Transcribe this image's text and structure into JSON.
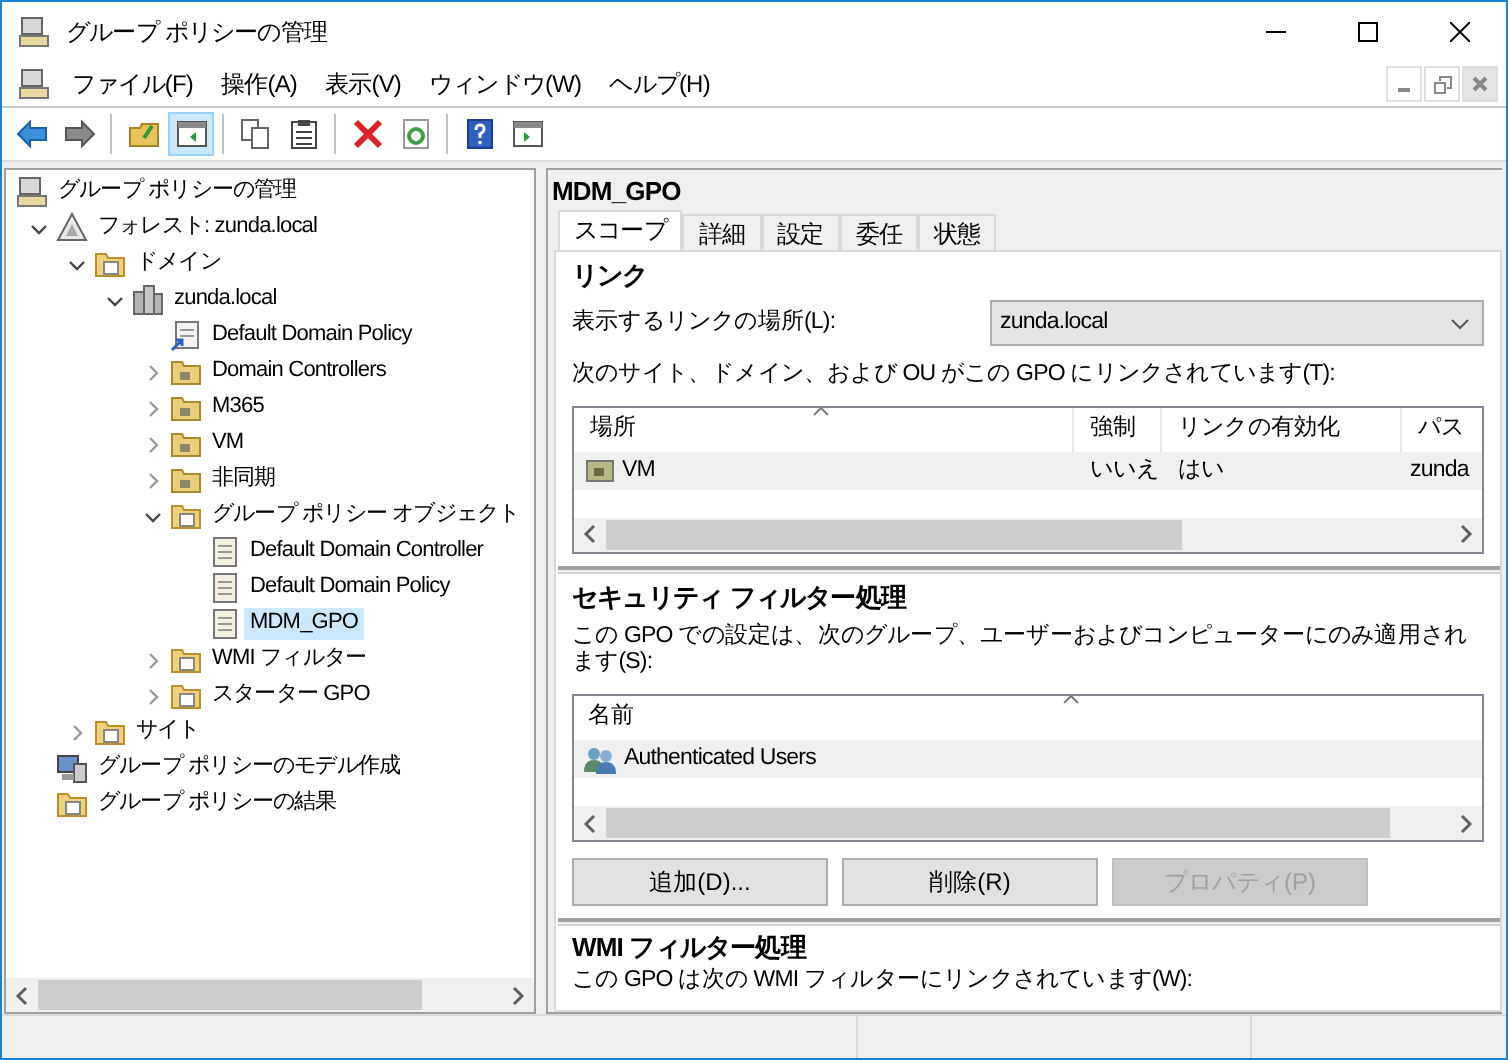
{
  "window": {
    "title": "グループ ポリシーの管理"
  },
  "menu": [
    {
      "label": "ファイル(F)"
    },
    {
      "label": "操作(A)"
    },
    {
      "label": "表示(V)"
    },
    {
      "label": "ウィンドウ(W)"
    },
    {
      "label": "ヘルプ(H)"
    }
  ],
  "toolbar": [
    {
      "kind": "back",
      "pressed": false
    },
    {
      "kind": "forward",
      "pressed": false
    },
    {
      "kind": "sep"
    },
    {
      "kind": "up",
      "pressed": false
    },
    {
      "kind": "tree",
      "pressed": true
    },
    {
      "kind": "sep"
    },
    {
      "kind": "copy",
      "pressed": false
    },
    {
      "kind": "paste",
      "pressed": false
    },
    {
      "kind": "sep"
    },
    {
      "kind": "delete",
      "pressed": false
    },
    {
      "kind": "refresh",
      "pressed": false
    },
    {
      "kind": "sep"
    },
    {
      "kind": "help",
      "pressed": false
    },
    {
      "kind": "panel",
      "pressed": false
    }
  ],
  "tree": [
    {
      "label": "グループ ポリシーの管理",
      "kind": "console",
      "selected": false,
      "children": [
        {
          "label": "フォレスト: zunda.local",
          "kind": "forest",
          "expanded": true,
          "selected": false,
          "children": [
            {
              "label": "ドメイン",
              "kind": "folder",
              "expanded": true,
              "selected": false,
              "children": [
                {
                  "label": "zunda.local",
                  "kind": "domain",
                  "expanded": true,
                  "selected": false,
                  "children": [
                    {
                      "label": "Default Domain Policy",
                      "kind": "link",
                      "selected": false
                    },
                    {
                      "label": "Domain Controllers",
                      "kind": "ou",
                      "expanded": false,
                      "selected": false
                    },
                    {
                      "label": "M365",
                      "kind": "ou",
                      "expanded": false,
                      "selected": false
                    },
                    {
                      "label": "VM",
                      "kind": "ou",
                      "expanded": false,
                      "selected": false
                    },
                    {
                      "label": "非同期",
                      "kind": "ou",
                      "expanded": false,
                      "selected": false
                    },
                    {
                      "label": "グループ ポリシー オブジェクト",
                      "kind": "folder",
                      "expanded": true,
                      "selected": false,
                      "children": [
                        {
                          "label": "Default Domain Controller",
                          "kind": "gpo",
                          "selected": false
                        },
                        {
                          "label": "Default Domain Policy",
                          "kind": "gpo",
                          "selected": false
                        },
                        {
                          "label": "MDM_GPO",
                          "kind": "gpo",
                          "selected": true
                        }
                      ]
                    },
                    {
                      "label": "WMI フィルター",
                      "kind": "folder",
                      "expanded": false,
                      "selected": false
                    },
                    {
                      "label": "スターター GPO",
                      "kind": "folder",
                      "expanded": false,
                      "selected": false
                    }
                  ]
                }
              ]
            },
            {
              "label": "サイト",
              "kind": "folder",
              "expanded": false,
              "selected": false
            }
          ]
        },
        {
          "label": "グループ ポリシーのモデル作成",
          "kind": "computer",
          "selected": false
        },
        {
          "label": "グループ ポリシーの結果",
          "kind": "folder",
          "selected": false
        }
      ]
    }
  ],
  "details": {
    "title": "MDM_GPO",
    "tabs": [
      {
        "label": "スコープ",
        "selected": true
      },
      {
        "label": "詳細",
        "selected": false
      },
      {
        "label": "設定",
        "selected": false
      },
      {
        "label": "委任",
        "selected": false
      },
      {
        "label": "状態",
        "selected": false
      }
    ],
    "links": {
      "heading": "リンク",
      "location_label": "表示するリンクの場所(L):",
      "location_value": "zunda.local",
      "description": "次のサイト、ドメイン、および OU がこの GPO にリンクされています(T):",
      "columns": [
        "場所",
        "強制",
        "リンクの有効化",
        "パス"
      ],
      "rows": [
        {
          "cells": [
            "VM",
            "いいえ",
            "はい",
            "zunda"
          ],
          "selected": true
        }
      ]
    },
    "security_filtering": {
      "heading": "セキュリティ フィルター処理",
      "description": "この GPO での設定は、次のグループ、ユーザーおよびコンピューターにのみ適用されます(S):",
      "columns": [
        "名前"
      ],
      "rows": [
        {
          "name": "Authenticated Users",
          "selected": true
        }
      ],
      "buttons": [
        {
          "label": "追加(D)...",
          "disabled": false
        },
        {
          "label": "削除(R)",
          "disabled": false
        },
        {
          "label": "プロパティ(P)",
          "disabled": true
        }
      ]
    },
    "wmi_filtering": {
      "heading": "WMI フィルター処理",
      "description": "この GPO は次の WMI フィルターにリンクされています(W):"
    }
  }
}
